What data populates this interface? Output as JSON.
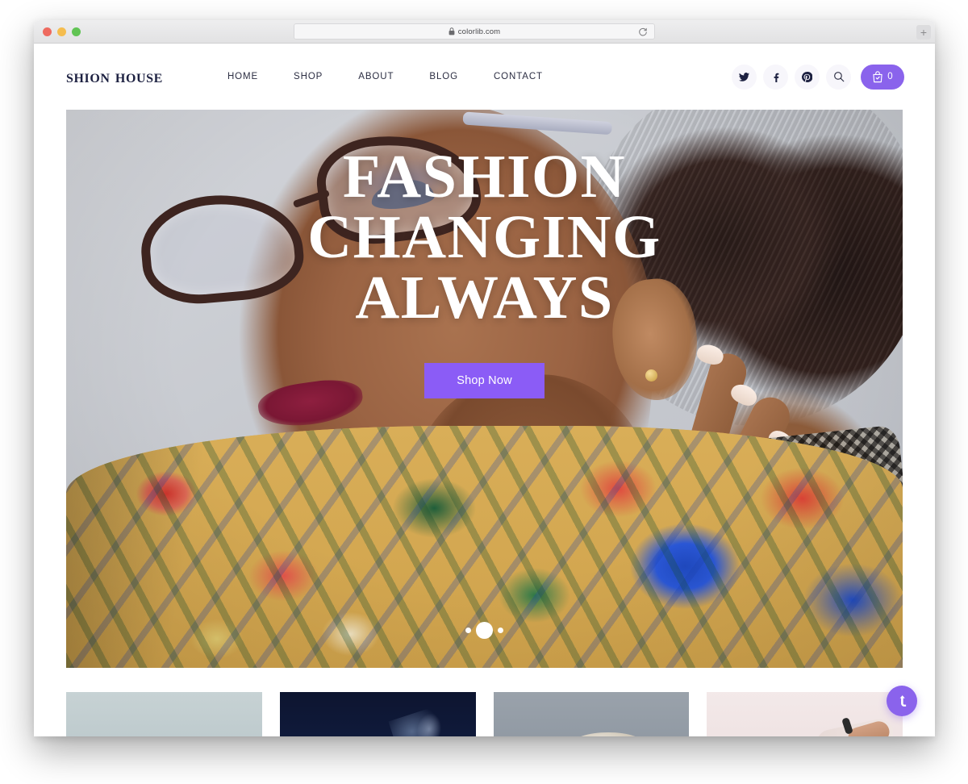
{
  "browser": {
    "url": "colorlib.com",
    "lock_icon": "lock-icon",
    "reload_icon": "reload-icon",
    "new_tab_label": "+",
    "traffic_lights": [
      {
        "name": "close",
        "color": "#ee6a5f"
      },
      {
        "name": "minimize",
        "color": "#f5bd4f"
      },
      {
        "name": "maximize",
        "color": "#61c454"
      }
    ]
  },
  "site": {
    "logo": "Shion House",
    "nav": [
      {
        "label": "HOME"
      },
      {
        "label": "SHOP"
      },
      {
        "label": "ABOUT"
      },
      {
        "label": "BLOG"
      },
      {
        "label": "CONTACT"
      }
    ],
    "social": [
      {
        "name": "twitter-icon",
        "label": "Twitter"
      },
      {
        "name": "facebook-icon",
        "label": "Facebook"
      },
      {
        "name": "pinterest-icon",
        "label": "Pinterest"
      }
    ],
    "search_icon": "search-icon",
    "cart": {
      "icon": "shopping-bag-icon",
      "count": "0"
    }
  },
  "hero": {
    "title_lines": [
      "FASHION",
      "CHANGING",
      "ALWAYS"
    ],
    "cta_label": "Shop Now",
    "slides": [
      {
        "index": "1",
        "active": false
      },
      {
        "index": "2",
        "active": true
      },
      {
        "index": "3",
        "active": false
      }
    ]
  },
  "cards": [
    {
      "name": "card-pale-blue"
    },
    {
      "name": "card-dark-navy"
    },
    {
      "name": "card-grey"
    },
    {
      "name": "card-pale-pink"
    }
  ],
  "back_to_top": {
    "icon": "arrow-up-icon"
  },
  "colors": {
    "accent_purple": "#8b5cf6",
    "cart_purple": "#8a63ec",
    "logo_navy": "#1d2141",
    "nav_text": "#2b2d42",
    "hero_backdrop": "#c9ccd2"
  }
}
